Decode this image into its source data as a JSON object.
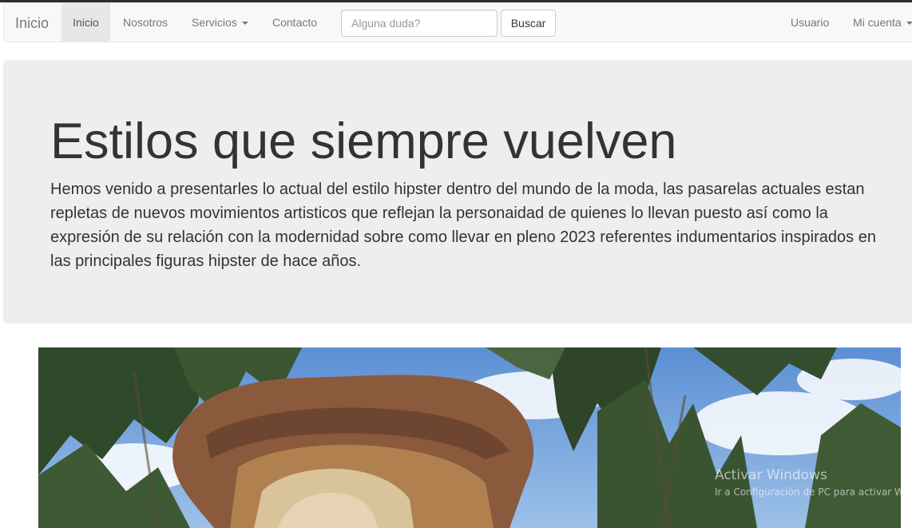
{
  "navbar": {
    "brand": "Inicio",
    "items": [
      {
        "label": "Inicio",
        "active": true
      },
      {
        "label": "Nosotros",
        "active": false
      },
      {
        "label": "Servicios",
        "active": false,
        "dropdown": true
      },
      {
        "label": "Contacto",
        "active": false
      }
    ],
    "search": {
      "placeholder": "Alguna duda?",
      "value": "",
      "button_label": "Buscar"
    },
    "right": [
      {
        "label": "Usuario"
      },
      {
        "label": "Mi cuenta",
        "dropdown": true
      }
    ]
  },
  "jumbotron": {
    "title": "Estilos que siempre vuelven",
    "text": "Hemos venido a presentarles lo actual del estilo hipster dentro del mundo de la moda, las pasarelas actuales estan repletas de nuevos movimientos artisticos que reflejan la personaidad de quienes lo llevan puesto así como la expresión de su relación con la modernidad sobre como llevar en pleno 2023 referentes indumentarios inspirados en las principales figuras hipster de hace años."
  },
  "watermark": {
    "title": "Activar Windows",
    "subtitle": "Ir a Configuración de PC para activar Windows."
  },
  "colors": {
    "navbar_bg": "#f8f8f8",
    "jumbotron_bg": "#eeeeee",
    "text": "#333333",
    "nav_text": "#777777"
  }
}
